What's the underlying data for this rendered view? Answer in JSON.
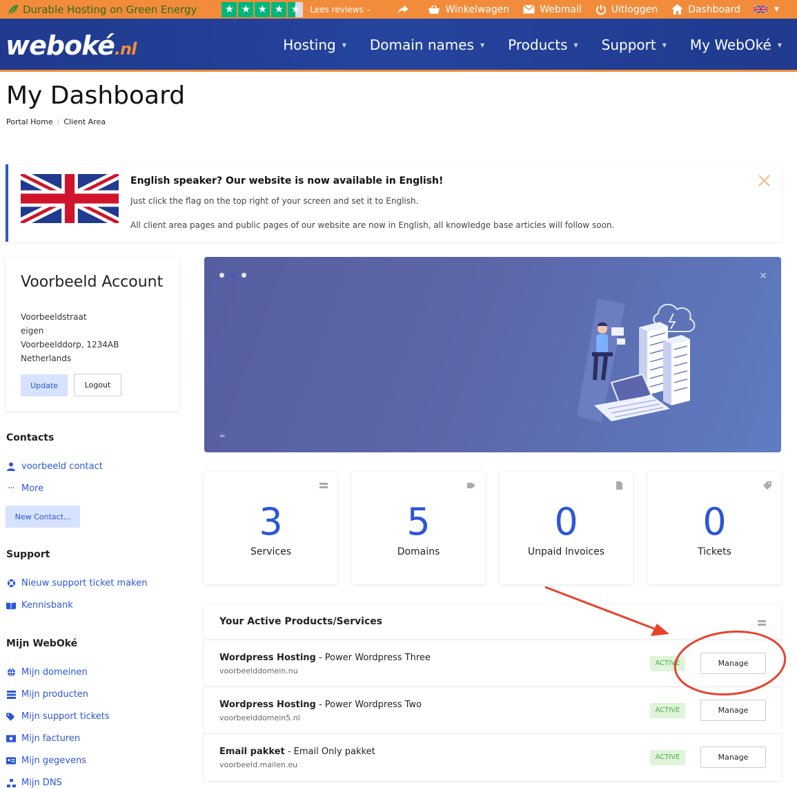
{
  "topbar": {
    "tagline": "Durable Hosting on Green Energy",
    "reviews_label": "Lees reviews",
    "links": [
      {
        "label": "",
        "icon": "share-icon"
      },
      {
        "label": "Winkelwagen",
        "icon": "basket-icon"
      },
      {
        "label": "Webmail",
        "icon": "mail-icon"
      },
      {
        "label": "Uitloggen",
        "icon": "power-icon"
      },
      {
        "label": "Dashboard",
        "icon": "home-icon"
      }
    ]
  },
  "brand": {
    "logo_main": "weboké",
    "logo_tld": ".nl"
  },
  "nav": {
    "items": [
      "Hosting",
      "Domain names",
      "Products",
      "Support",
      "My WebOké"
    ]
  },
  "header": {
    "title": "My Dashboard",
    "breadcrumb": [
      "Portal Home",
      "Client Area"
    ]
  },
  "notice": {
    "heading": "English speaker? Our website is now available in English!",
    "line1": "Just click the flag on the top right of your screen and set it to English.",
    "line2": "All client area pages and public pages of our website are now in English, all knowledge base articles will follow soon."
  },
  "account": {
    "name": "Voorbeeld Account",
    "address": [
      "Voorbeeldstraat",
      "eigen",
      "Voorbeelddorp, 1234AB",
      "Netherlands"
    ],
    "update_label": "Update",
    "logout_label": "Logout"
  },
  "sidebar": {
    "contacts_heading": "Contacts",
    "contact_link": "voorbeeld contact",
    "more_link": "More",
    "new_contact_label": "New Contact...",
    "support_heading": "Support",
    "support_links": [
      "Nieuw support ticket maken",
      "Kennisbank"
    ],
    "mijn_heading": "Mijn WebOké",
    "mijn_links": [
      "Mijn domeinen",
      "Mijn producten",
      "Mijn support tickets",
      "Mijn facturen",
      "Mijn gegevens",
      "Mijn DNS"
    ]
  },
  "stats": [
    {
      "value": "3",
      "label": "Services",
      "icon": "server-icon"
    },
    {
      "value": "5",
      "label": "Domains",
      "icon": "tag-icon"
    },
    {
      "value": "0",
      "label": "Unpaid Invoices",
      "icon": "document-icon"
    },
    {
      "value": "0",
      "label": "Tickets",
      "icon": "ticket-icon"
    }
  ],
  "products": {
    "heading": "Your Active Products/Services",
    "rows": [
      {
        "name": "Wordpress Hosting",
        "plan": " - Power Wordpress Three",
        "domain": "voorbeelddomein.nu",
        "status": "ACTIVE",
        "action": "Manage"
      },
      {
        "name": "Wordpress Hosting",
        "plan": " - Power Wordpress Two",
        "domain": "voorbeelddomein5.nl",
        "status": "ACTIVE",
        "action": "Manage"
      },
      {
        "name": "Email pakket",
        "plan": " - Email Only pakket",
        "domain": "voorbeeld.mailen.eu",
        "status": "ACTIVE",
        "action": "Manage"
      }
    ]
  },
  "colors": {
    "orange": "#f28c3b",
    "navy": "#1f3a8e",
    "link_blue": "#2b56d6",
    "annotation_red": "#e8412c",
    "active_green": "#4caf50"
  }
}
